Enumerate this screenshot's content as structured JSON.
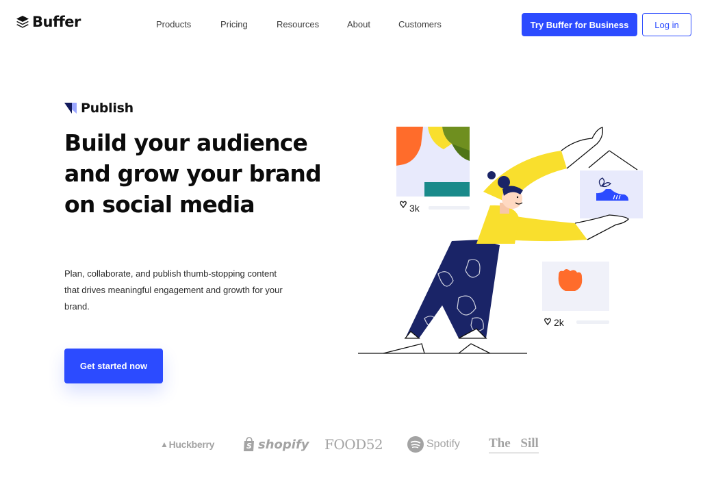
{
  "header": {
    "logo_text": "Buffer",
    "nav": [
      "Products",
      "Pricing",
      "Resources",
      "About",
      "Customers"
    ],
    "cta_business": "Try Buffer for Business",
    "login": "Log in"
  },
  "hero": {
    "product_name": "Publish",
    "title": "Build your audience and grow your brand on social media",
    "description": "Plan, collaborate, and publish thumb-stopping content that drives meaningful engagement and growth for your brand.",
    "cta": "Get started now"
  },
  "illustration": {
    "likes_top": "3k",
    "likes_bottom": "2k"
  },
  "customers": {
    "huckberry": "Huckberry",
    "shopify": "shopify",
    "food52": "FOOD52",
    "spotify": "Spotify",
    "thesill": "The Sill"
  },
  "colors": {
    "accent": "#2c4bff",
    "illustration_yellow": "#f9df2d",
    "illustration_navy": "#1a2467",
    "illustration_orange": "#ff6c2b",
    "logos_gray": "#a3a3a3"
  },
  "icons": {
    "logo": "buffer-stack-icon",
    "product": "publish-arrow-icon",
    "like": "heart-outline-icon"
  }
}
